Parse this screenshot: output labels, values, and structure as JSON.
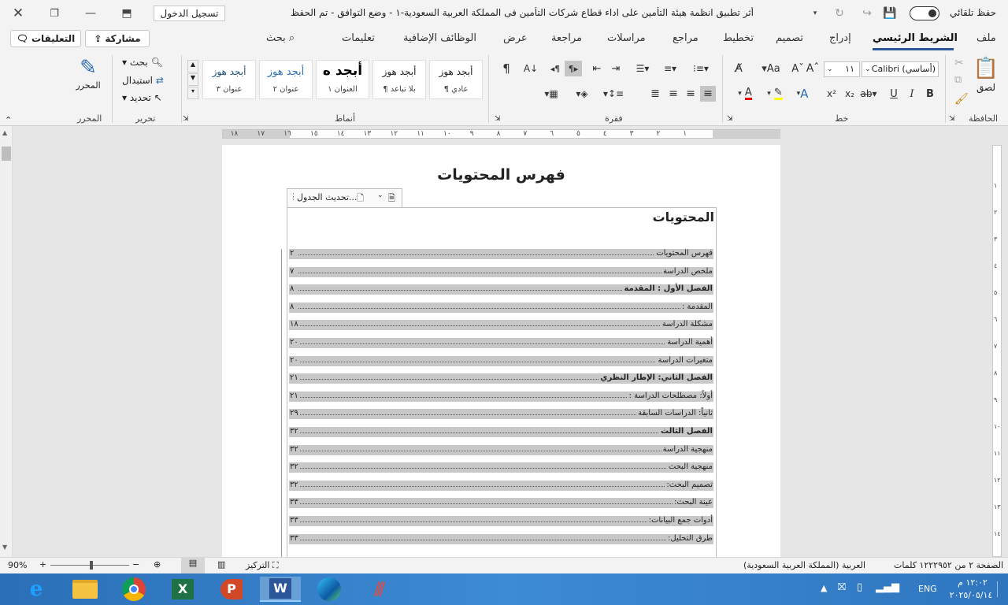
{
  "titlebar": {
    "autosave_label": "حفظ تلقائي",
    "doc_title": "أثر تطبيق انظمة هيئة التأمين على اداء قطاع شركات التأمين فى المملكة العربية السعودية-١  -  وضع التوافق  -  تم الحفظ",
    "signin_label": "تسجيل الدخول"
  },
  "tabs": [
    "ملف",
    "الشريط الرئيسي",
    "إدراج",
    "تصميم",
    "تخطيط",
    "مراجع",
    "مراسلات",
    "مراجعة",
    "عرض",
    "الوظائف الإضافية",
    "تعليمات",
    "بحث"
  ],
  "share_label": "مشاركة",
  "comments_label": "التعليقات",
  "ribbon": {
    "clipboard": {
      "paste": "لصق",
      "label": "الحافظة"
    },
    "font": {
      "name": "Calibri (أساسي)",
      "size": "١١",
      "label": "خط"
    },
    "paragraph": {
      "label": "فقرة"
    },
    "styles": {
      "label": "أنماط",
      "items": [
        {
          "sample": "أبجد هوز",
          "name": "¶ عادي"
        },
        {
          "sample": "أبجد هوز",
          "name": "¶ بلا تباعد"
        },
        {
          "sample": "أبجد ه",
          "name": "العنوان ١"
        },
        {
          "sample": "أبجد هوز",
          "name": "عنوان ٢"
        },
        {
          "sample": "أبجد هوز",
          "name": "عنوان ٣"
        }
      ]
    },
    "editing": {
      "find": "بحث",
      "replace": "استبدال",
      "select": "تحديد",
      "label": "تحرير"
    },
    "editor": {
      "name": "المحرر",
      "label": "المحرر"
    }
  },
  "ruler": [
    "١",
    "٢",
    "٣",
    "٤",
    "٥",
    "٦",
    "٧",
    "٨",
    "٩",
    "١٠",
    "١١",
    "١٢",
    "١٣",
    "١٤",
    "١٥",
    "١٦",
    "١٧",
    "١٨"
  ],
  "vruler": [
    "١",
    "٢",
    "٣",
    "٤",
    "٥",
    "٦",
    "٧",
    "٨",
    "٩",
    "١٠",
    "١١",
    "١٢",
    "١٣",
    "١٤"
  ],
  "document": {
    "page_title": "فهرس المحتويات",
    "update_table": "تحديث الجدول...",
    "toc_heading": "المحتويات",
    "toc": [
      {
        "text": "فهرس المحتويات",
        "page": "٢",
        "bold": false
      },
      {
        "text": "ملخص الدراسة",
        "page": "٧",
        "bold": false
      },
      {
        "text": "الفصل الأول : المقدمة",
        "page": "٨",
        "bold": true
      },
      {
        "text": "المقدمة :",
        "page": "٨",
        "bold": false
      },
      {
        "text": "مشكلة الدراسة",
        "page": "١٨",
        "bold": false
      },
      {
        "text": "أهمية الدراسة",
        "page": "٢٠",
        "bold": false
      },
      {
        "text": "متغيرات الدراسة",
        "page": "٢٠",
        "bold": false
      },
      {
        "text": "الفصل الثاني: الإطار النظري",
        "page": "٢١",
        "bold": true
      },
      {
        "text": "أولاً: مصطلحات الدراسة :",
        "page": "٢١",
        "bold": false
      },
      {
        "text": "ثانياً: الدراسات السابقة",
        "page": "٢٩",
        "bold": false
      },
      {
        "text": "الفصل الثالث",
        "page": "٣٢",
        "bold": true
      },
      {
        "text": "منهجية الدراسة",
        "page": "٣٢",
        "bold": false
      },
      {
        "text": "منهجية البحث",
        "page": "٣٢",
        "bold": false
      },
      {
        "text": "تصميم البحث:",
        "page": "٣٢",
        "bold": false
      },
      {
        "text": "عينة البحث:",
        "page": "٣٣",
        "bold": false
      },
      {
        "text": "أدوات جمع البيانات:",
        "page": "٣٣",
        "bold": false
      },
      {
        "text": "طرق التحليل:",
        "page": "٣٣",
        "bold": false
      }
    ]
  },
  "status": {
    "page": "الصفحة ٢ من ٥٢",
    "words": "١٢٢٢٩ كلمات",
    "language": "العربية (المملكة العربية السعودية)",
    "focus": "التركيز",
    "zoom": "90%"
  },
  "taskbar": {
    "lang": "ENG",
    "time": "١٢:٠٢ م",
    "date": "٢٠٢٥/٠٥/١٤"
  }
}
